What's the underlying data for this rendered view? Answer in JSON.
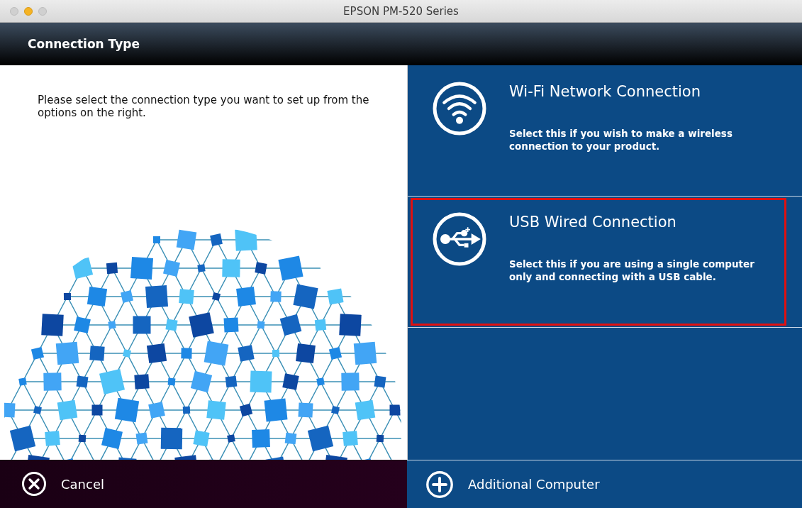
{
  "window": {
    "title": "EPSON PM-520 Series"
  },
  "header": {
    "title": "Connection Type"
  },
  "instructions": "Please select the connection type you want to set up from the options on the right.",
  "options": [
    {
      "kind": "wifi",
      "title": "Wi-Fi Network Connection",
      "description": "Select this if you wish to make a wireless connection to your product.",
      "selected": false
    },
    {
      "kind": "usb",
      "title": "USB Wired Connection",
      "description": "Select this if you are using a single computer only and connecting with a USB cable.",
      "selected": true
    }
  ],
  "footer": {
    "cancel": "Cancel",
    "additional": "Additional Computer"
  }
}
